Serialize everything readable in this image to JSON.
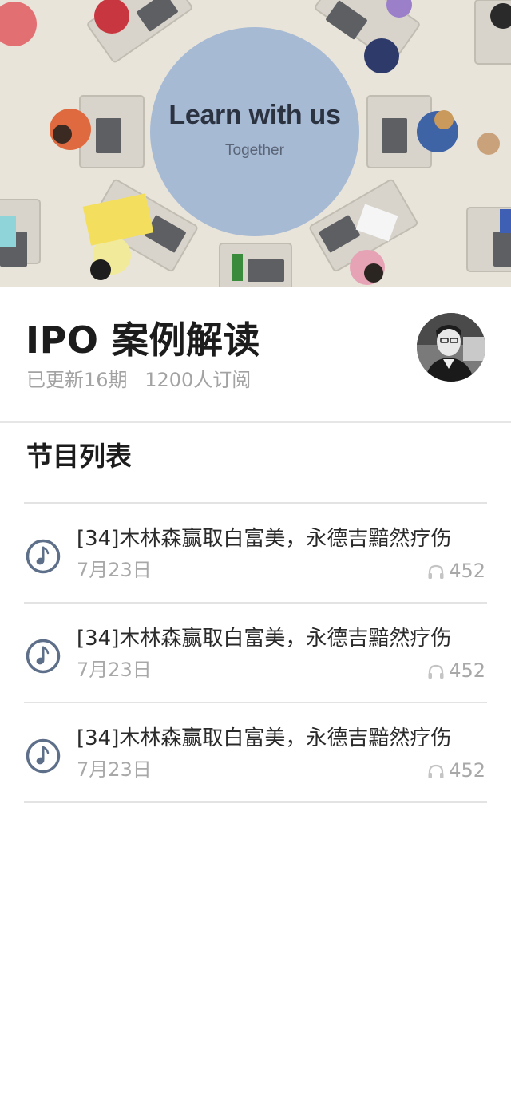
{
  "banner": {
    "title": "Learn with us",
    "subtitle": "Together"
  },
  "course": {
    "title": "IPO 案例解读",
    "updated": "已更新16期",
    "subscribers": "1200人订阅"
  },
  "section": {
    "title": "节目列表"
  },
  "episodes": [
    {
      "title": "[34]木林森赢取白富美，永德吉黯然疗伤",
      "date": "7月23日",
      "plays": "452",
      "icon": "music-note-icon"
    },
    {
      "title": "[34]木林森赢取白富美，永德吉黯然疗伤",
      "date": "7月23日",
      "plays": "452",
      "icon": "music-note-icon"
    },
    {
      "title": "[34]木林森赢取白富美，永德吉黯然疗伤",
      "date": "7月23日",
      "plays": "452",
      "icon": "music-note-icon"
    }
  ],
  "colors": {
    "accent": "#5e6f8a",
    "circle": "#a7bad4",
    "muted_text": "#a3a3a3",
    "divider": "#e3e3e3"
  }
}
